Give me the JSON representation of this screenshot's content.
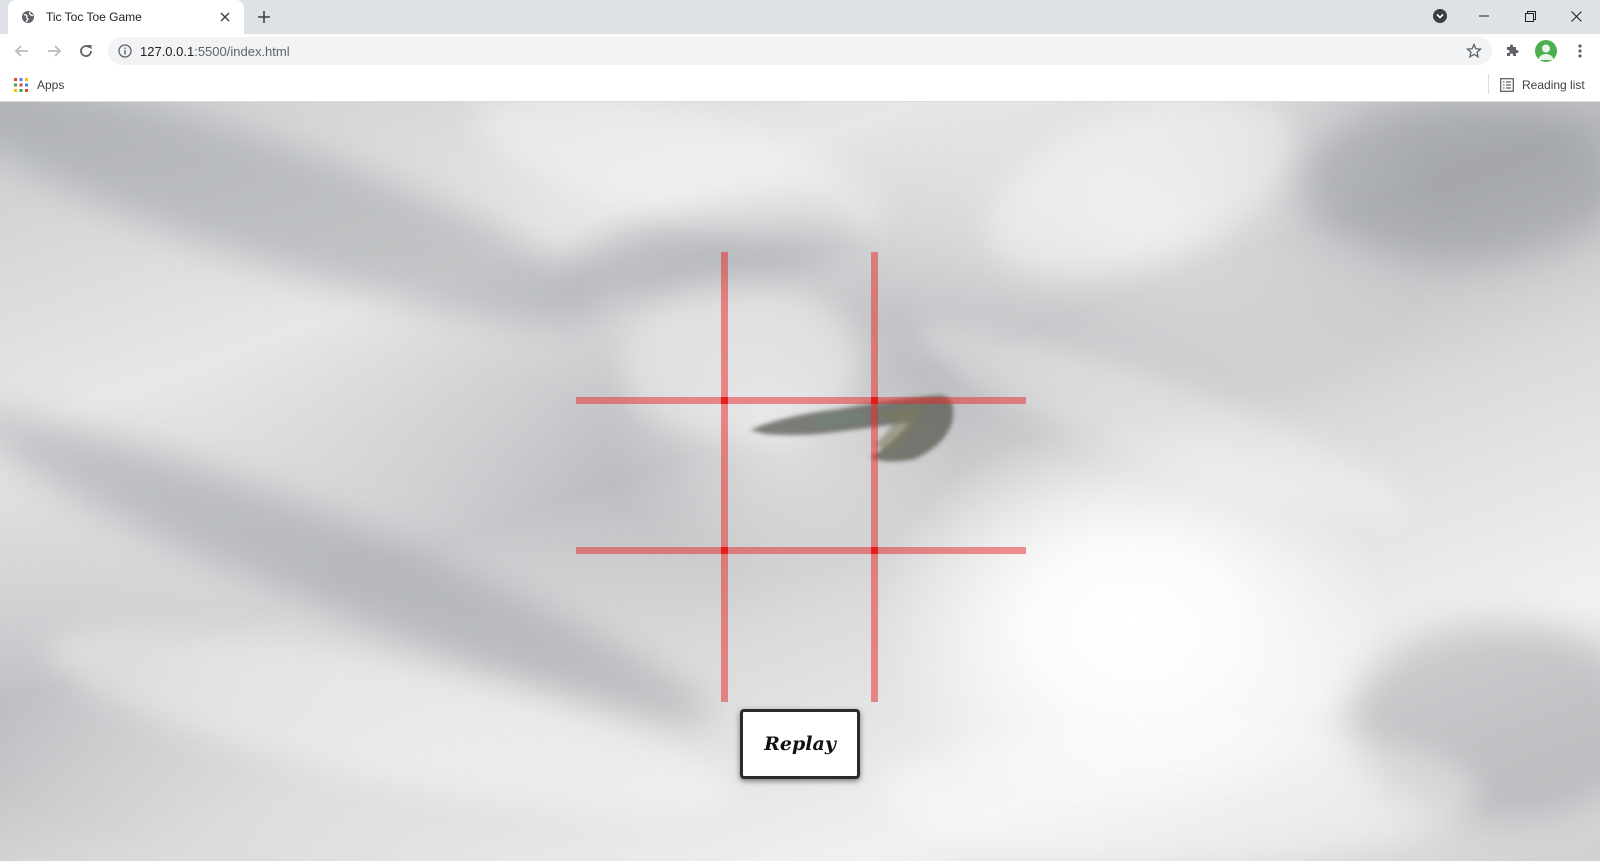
{
  "browser": {
    "tab": {
      "title": "Tic Toc Toe Game",
      "favicon": "globe-icon"
    },
    "url": {
      "host": "127.0.0.1",
      "rest": ":5500/index.html"
    },
    "bookmarks": {
      "apps_label": "Apps",
      "reading_list_label": "Reading list"
    },
    "profile_color": "#4caf50"
  },
  "game": {
    "grid_color": "#e82828",
    "cells": [
      "",
      "",
      "",
      "",
      "",
      "",
      "",
      "",
      ""
    ],
    "replay_label": "Replay"
  }
}
